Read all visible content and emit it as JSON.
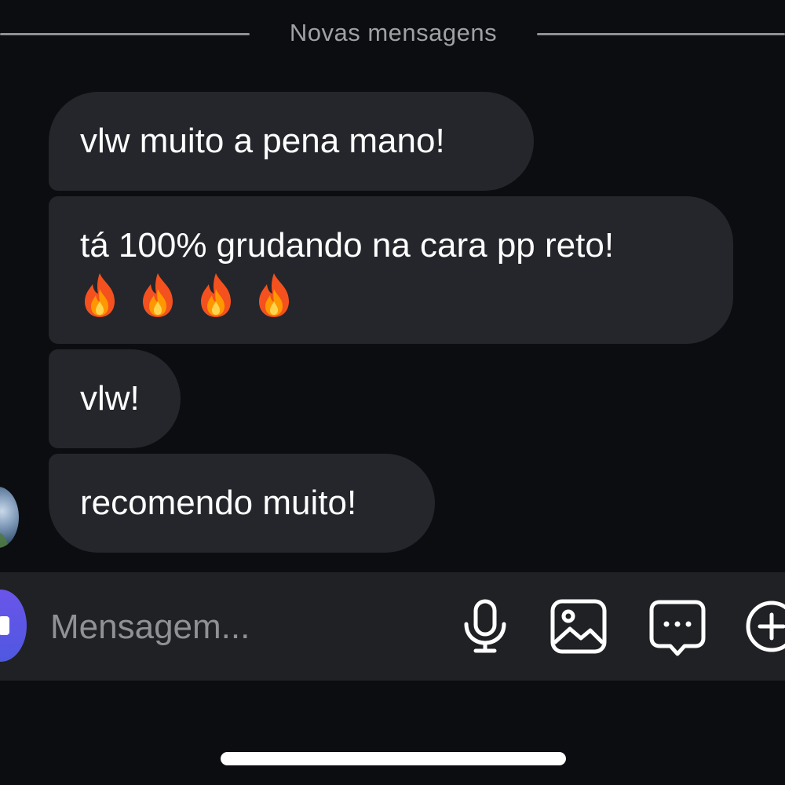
{
  "divider": {
    "label": "Novas mensagens"
  },
  "messages": [
    {
      "text": "vlw muito a pena mano!"
    },
    {
      "text": "tá 100% grudando na cara pp reto!",
      "emoji": [
        "🔥",
        "🔥",
        "🔥",
        "🔥"
      ]
    },
    {
      "text": "vlw!"
    },
    {
      "text": "recomendo muito!"
    }
  ],
  "composer": {
    "placeholder": "Mensagem...",
    "icons": [
      "camera-icon",
      "microphone-icon",
      "gallery-icon",
      "sticker-icon",
      "plus-icon"
    ]
  },
  "colors": {
    "background": "#0c0d10",
    "bubble": "#24262b",
    "composer": "#1f2124",
    "accent": "#5b4fe6",
    "placeholder": "#8f9196"
  }
}
